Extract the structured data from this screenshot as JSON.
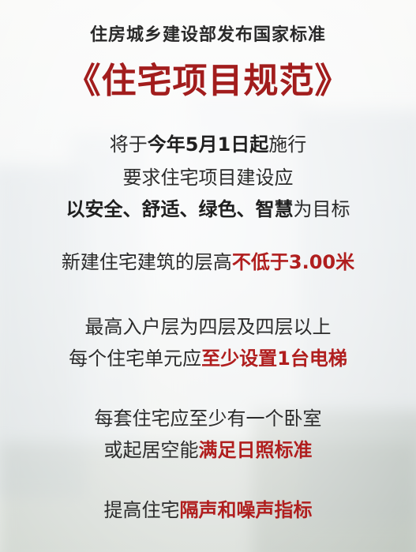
{
  "header": {
    "kicker": "住房城乡建设部发布国家标准",
    "title": "《住宅项目规范》"
  },
  "paragraphs": {
    "p1": {
      "line1_a": "将于",
      "line1_b": "今年5月1日起",
      "line1_c": "施行",
      "line2": "要求住宅项目建设应",
      "line3_a": "以安全、舒适、绿色、智慧",
      "line3_b": "为目标"
    },
    "p2": {
      "line1_a": "新建住宅建筑的层高",
      "line1_b": "不低于3.00米"
    },
    "p3": {
      "line1": "最高入户层为四层及四层以上",
      "line2_a": "每个住宅单元应",
      "line2_b": "至少设置1台电梯"
    },
    "p4": {
      "line1": "每套住宅应至少有一个卧室",
      "line2_a": "或起居空能",
      "line2_b": "满足日照标准"
    },
    "p5": {
      "line1_a": "提高住宅",
      "line1_b": "隔声和噪声指标"
    }
  },
  "colors": {
    "accent_red": "#b01e1e",
    "title_red": "#a21d1d",
    "text": "#2b2b2b"
  }
}
